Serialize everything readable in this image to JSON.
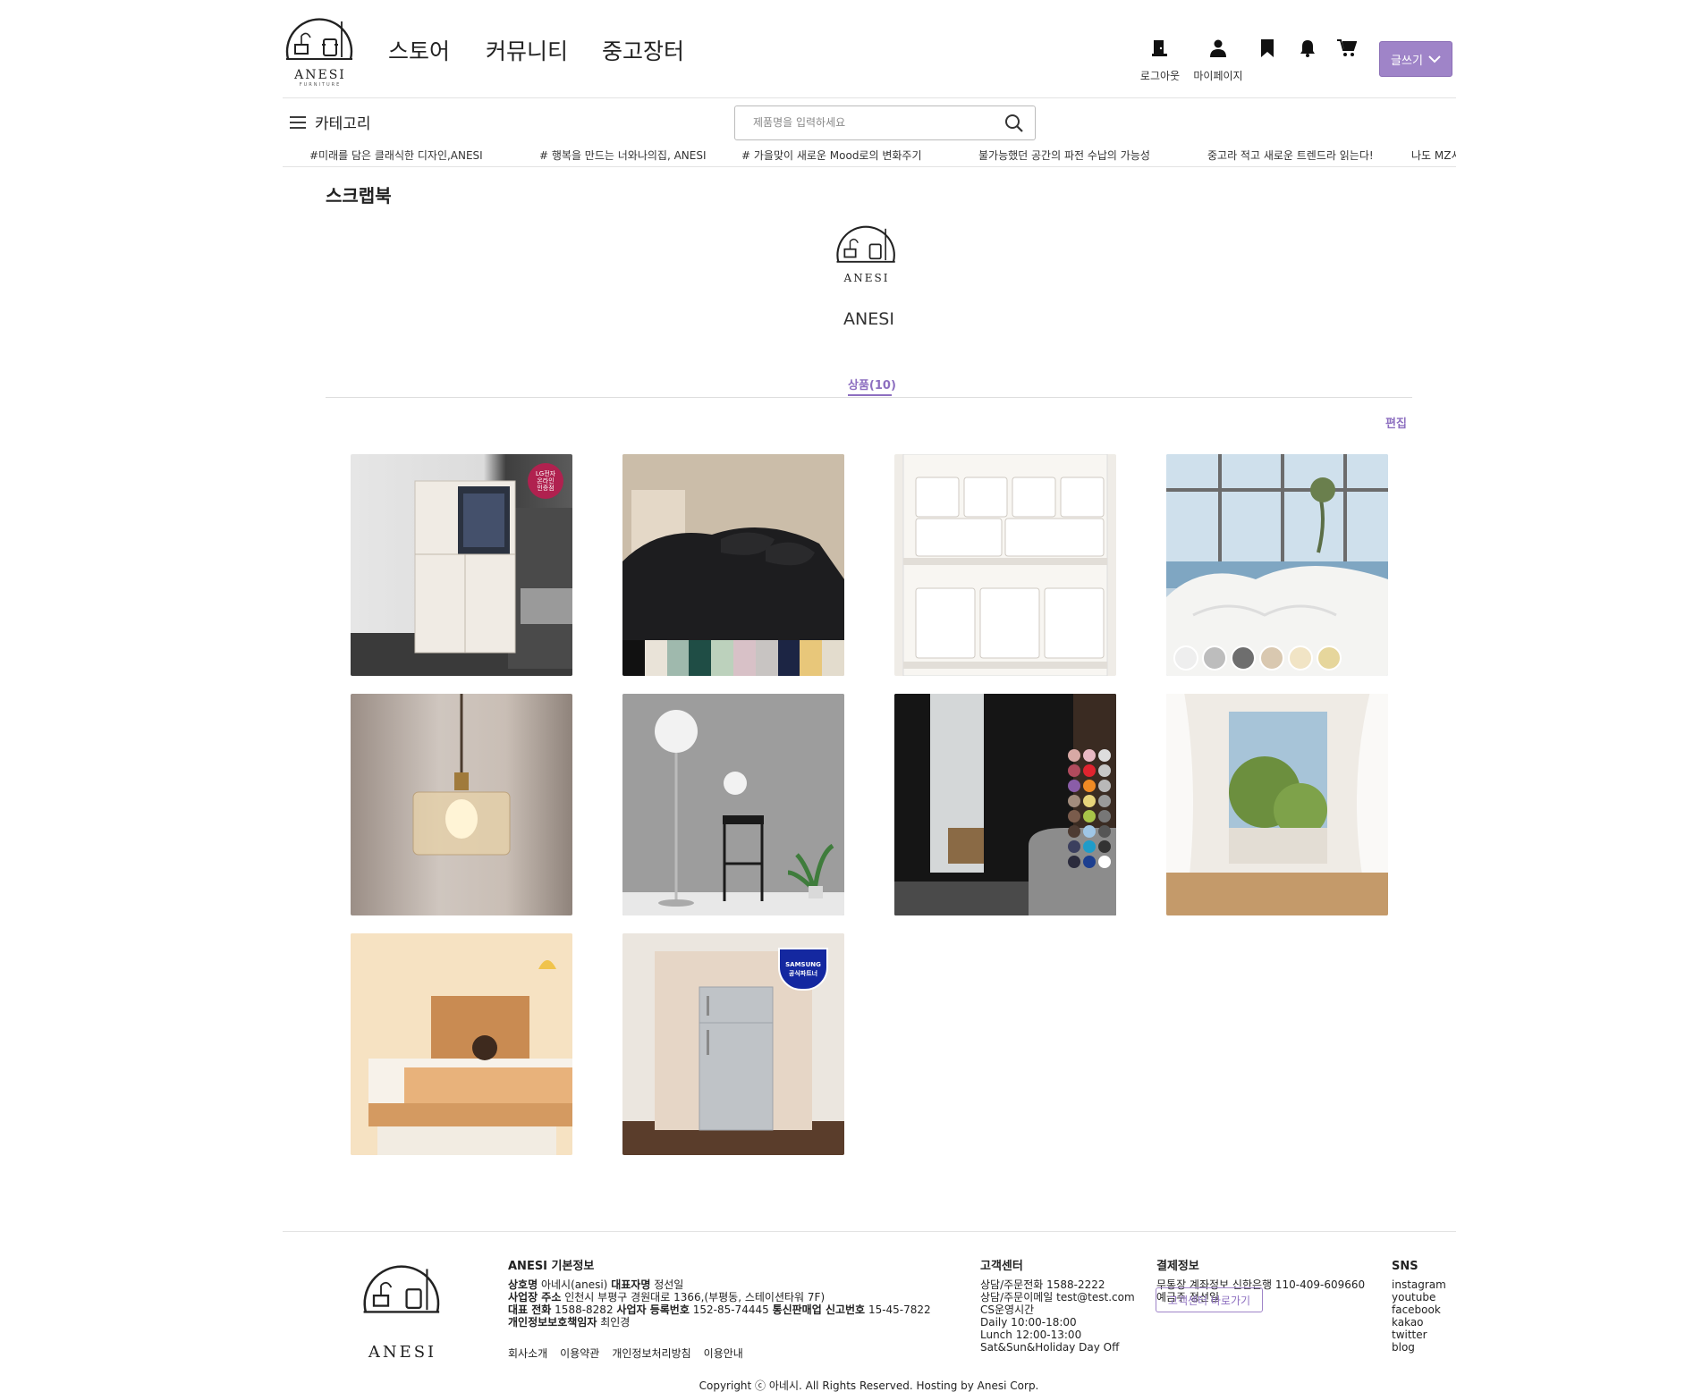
{
  "brand": {
    "name": "ANESI",
    "sub": "FURNITURE"
  },
  "nav": [
    "스토어",
    "커뮤니티",
    "중고장터"
  ],
  "header_actions": {
    "logout": "로그아웃",
    "mypage": "마이페이지",
    "write": "글쓰기"
  },
  "category_label": "카테고리",
  "search": {
    "placeholder": "제품명을 입력하세요"
  },
  "marquee": [
    "#미래를 담은 클래식한 디자인,ANESI",
    "# 행복을 만드는 너와나의집, ANESI",
    "# 가을맞이 새로운 Mood로의 변화주기",
    "불가능했던 공간의 파전 수납의 가능성",
    "중고라 적고 새로운 트렌드라 읽는다!",
    "나도 MZ시"
  ],
  "page_title": "스크랩북",
  "profile": {
    "name": "ANESI"
  },
  "tab": "상품(10)",
  "edit": "편집",
  "products": [
    {
      "badge": "LG전자\n온라인\n인증점"
    },
    {
      "badge": ""
    },
    {
      "badge": ""
    },
    {
      "badge": ""
    },
    {
      "badge": ""
    },
    {
      "badge": ""
    },
    {
      "badge": ""
    },
    {
      "badge": ""
    },
    {
      "badge": ""
    },
    {
      "badge": "SAMSUNG\n공식파트너"
    }
  ],
  "footer": {
    "info_title": "ANESI 기본정보",
    "line1_k1": "상호명",
    "line1_v1": "아네시(anesi)",
    "line1_k2": "대표자명",
    "line1_v2": "정선일",
    "line2_k": "사업장 주소",
    "line2_v": "인천시 부평구 경원대로 1366,(부평동, 스테이션타워 7F)",
    "line3_k1": "대표 전화",
    "line3_v1": "1588-8282",
    "line3_k2": "사업자 등록번호",
    "line3_v2": "152-85-74445",
    "line3_k3": "통신판매업 신고번호",
    "line3_v3": "15-45-7822",
    "line4_k": "개인정보보호책임자",
    "line4_v": "최인경",
    "links": [
      "회사소개",
      "이용약관",
      "개인정보처리방침",
      "이용안내"
    ],
    "cs_title": "고객센터",
    "cs_lines": [
      "상담/주문전화 1588-2222",
      "상담/주문이메일 test@test.com",
      "CS운영시간",
      "Daily 10:00-18:00",
      "Lunch 12:00-13:00",
      "Sat&Sun&Holiday Day Off"
    ],
    "pay_title": "결제정보",
    "pay_lines": [
      "무통장 계좌정보 신한은행 110-409-609660",
      "예금주 정선일"
    ],
    "cs_button": "고객센터 바로가기",
    "sns_title": "SNS",
    "sns": [
      "instagram",
      "youtube",
      "facebook",
      "kakao",
      "twitter",
      "blog"
    ],
    "copyright": "Copyright ⓒ 아네시. All Rights Reserved. Hosting by Anesi Corp."
  }
}
